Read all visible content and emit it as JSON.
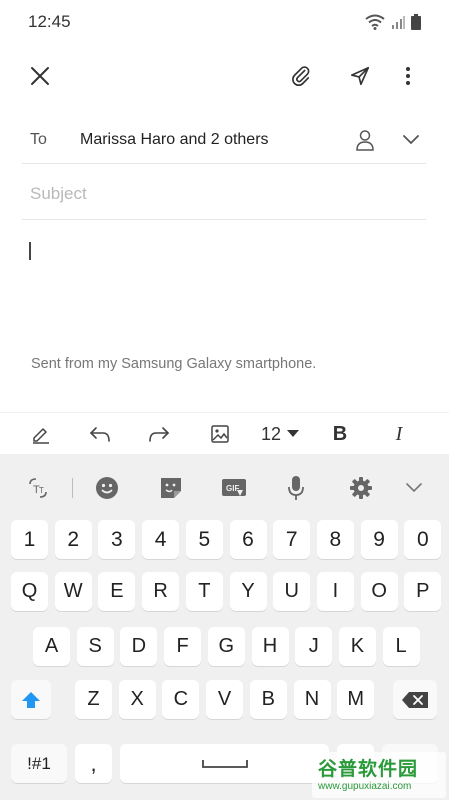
{
  "status": {
    "time": "12:45"
  },
  "toolbar": {
    "close_icon": "close-icon",
    "attach_icon": "paperclip-icon",
    "send_icon": "send-icon",
    "more_icon": "more-vertical-icon"
  },
  "compose": {
    "to_label": "To",
    "recipients": "Marissa Haro and 2 others",
    "subject_placeholder": "Subject",
    "subject_value": "",
    "signature": "Sent from my Samsung Galaxy smartphone."
  },
  "format_bar": {
    "font_size": "12",
    "bold_label": "B",
    "italic_label": "I"
  },
  "keyboard": {
    "number_row": [
      "1",
      "2",
      "3",
      "4",
      "5",
      "6",
      "7",
      "8",
      "9",
      "0"
    ],
    "row1": [
      "Q",
      "W",
      "E",
      "R",
      "T",
      "Y",
      "U",
      "I",
      "O",
      "P"
    ],
    "row2": [
      "A",
      "S",
      "D",
      "F",
      "G",
      "H",
      "J",
      "K",
      "L"
    ],
    "row3": [
      "Z",
      "X",
      "C",
      "V",
      "B",
      "N",
      "M"
    ],
    "symbols_label": "!#1",
    "comma_label": ","
  },
  "watermark": {
    "title": "谷普软件园",
    "url": "www.gupuxiazai.com"
  },
  "colors": {
    "accent": "#2196f3",
    "background": "#ffffff",
    "keyboard_bg": "#f0f0f0"
  }
}
